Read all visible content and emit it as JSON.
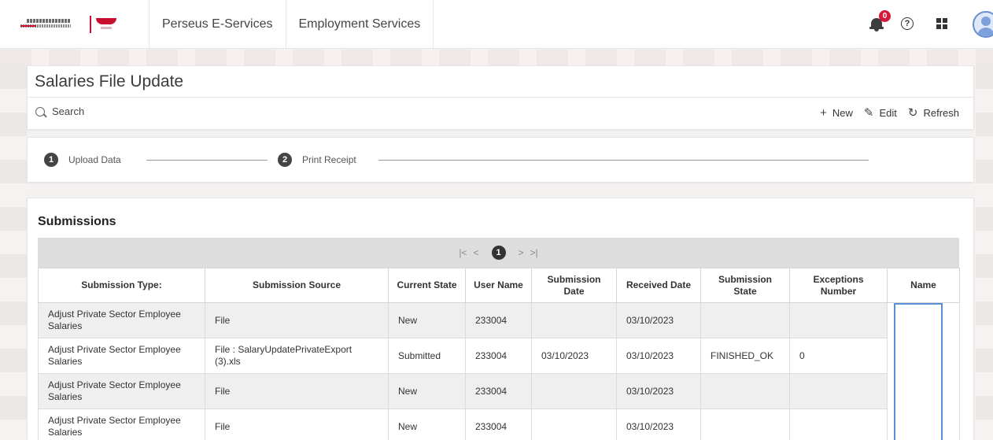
{
  "header": {
    "nav": [
      "Perseus E-Services",
      "Employment Services"
    ],
    "notification_count": "0",
    "help_symbol": "?"
  },
  "page": {
    "title": "Salaries File Update",
    "search_label": "Search",
    "actions": [
      {
        "label": "New",
        "icon": "plus-icon"
      },
      {
        "label": "Edit",
        "icon": "pencil-icon"
      },
      {
        "label": "Refresh",
        "icon": "refresh-icon"
      }
    ]
  },
  "steps": [
    {
      "num": "1",
      "label": "Upload Data"
    },
    {
      "num": "2",
      "label": "Print Receipt"
    }
  ],
  "submissions": {
    "title": "Submissions",
    "pager": {
      "first": "|<",
      "prev": "<",
      "current": "1",
      "next": ">",
      "last": ">|"
    },
    "columns": [
      "Submission Type:",
      "Submission Source",
      "Current State",
      "User Name",
      "Submission Date",
      "Received Date",
      "Submission State",
      "Exceptions Number",
      "Name"
    ],
    "rows": [
      [
        "Adjust Private Sector Employee Salaries",
        "File",
        "New",
        "233004",
        "",
        "03/10/2023",
        "",
        ""
      ],
      [
        "Adjust Private Sector Employee Salaries",
        "File : SalaryUpdatePrivateExport (3).xls",
        "Submitted",
        "233004",
        "03/10/2023",
        "03/10/2023",
        "FINISHED_OK",
        "0"
      ],
      [
        "Adjust Private Sector Employee Salaries",
        "File",
        "New",
        "233004",
        "",
        "03/10/2023",
        "",
        ""
      ],
      [
        "Adjust Private Sector Employee Salaries",
        "File",
        "New",
        "233004",
        "",
        "03/10/2023",
        "",
        ""
      ]
    ]
  }
}
